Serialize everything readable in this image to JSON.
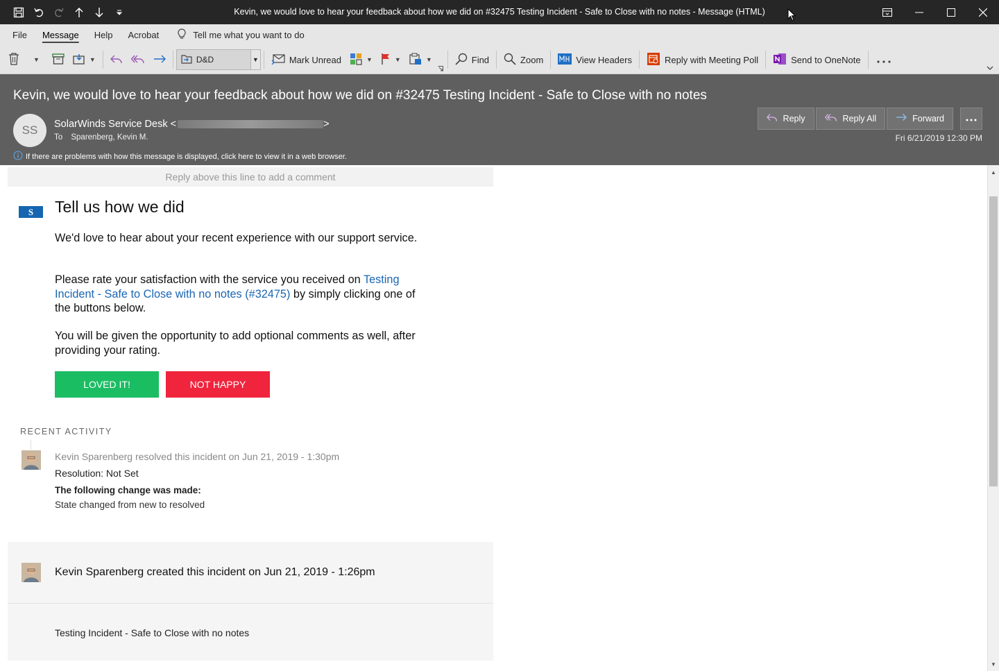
{
  "window": {
    "title": "Kevin, we would love to hear your feedback about how we did on #32475 Testing Incident - Safe to Close with no notes  -  Message (HTML)"
  },
  "menu": {
    "tabs": [
      "File",
      "Message",
      "Help",
      "Acrobat"
    ],
    "active_tab": "Message",
    "tell_me": "Tell me what you want to do"
  },
  "ribbon": {
    "move_to_folder": "D&D",
    "mark_unread": "Mark Unread",
    "find": "Find",
    "zoom": "Zoom",
    "view_headers": "View Headers",
    "reply_meeting_poll": "Reply with Meeting Poll",
    "send_onenote": "Send to OneNote"
  },
  "message": {
    "subject": "Kevin, we would love to hear your feedback about how we did on #32475 Testing Incident - Safe to Close with no notes",
    "avatar_initials": "SS",
    "sender_name": "SolarWinds Service Desk <",
    "sender_end": ">",
    "to_label": "To",
    "to": "Sparenberg, Kevin M.",
    "info": "If there are problems with how this message is displayed, click here to view it in a web browser.",
    "date": "Fri 6/21/2019 12:30 PM",
    "actions": {
      "reply": "Reply",
      "reply_all": "Reply All",
      "forward": "Forward"
    }
  },
  "body": {
    "reply_line": "Reply above this line to add a comment",
    "logo_letter": "S",
    "heading": "Tell us how we did",
    "para1": "We'd love to hear about your recent experience with our support service.",
    "para2_before": "Please rate your satisfaction with the service you received on ",
    "para2_link": "Testing Incident - Safe to Close with no notes (#32475)",
    "para2_after": " by simply clicking one of the buttons below.",
    "para3": "You will be given the opportunity to add optional comments as well, after providing your rating.",
    "btn_loved": "LOVED IT!",
    "btn_not_happy": "NOT HAPPY",
    "recent_activity_title": "RECENT ACTIVITY",
    "activity1": {
      "meta": "Kevin Sparenberg resolved this incident on Jun 21, 2019 - 1:30pm",
      "resolution": "Resolution: Not Set",
      "change_heading": "The following change was made:",
      "change": "State changed from new to resolved"
    },
    "created": "Kevin Sparenberg created this incident on Jun 21, 2019 - 1:26pm",
    "incident_title": "Testing Incident - Safe to Close with no notes"
  },
  "colors": {
    "loved": "#1bbd63",
    "not_happy": "#f0243d",
    "link": "#1a66b3",
    "header_bg": "#5f5f5f",
    "titlebar_bg": "#262626"
  }
}
